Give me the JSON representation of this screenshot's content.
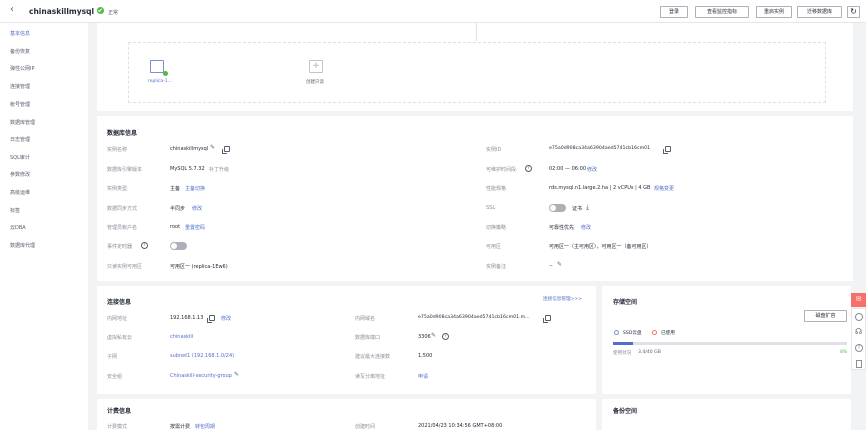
{
  "header": {
    "title": "chinaskillmysql",
    "status": "正常",
    "buttons": [
      "登录",
      "查看监控指标",
      "重启实例",
      "迁移数据库"
    ],
    "refresh_icon": "refresh-icon"
  },
  "sidebar": {
    "items": [
      "基本信息",
      "备份恢复",
      "弹性公网IP",
      "连接管理",
      "帐号管理",
      "数据库管理",
      "日志管理",
      "SQL审计",
      "参数修改",
      "高级运维",
      "标签",
      "云DBA",
      "数据库代理"
    ],
    "active": 0
  },
  "topology": {
    "node_label": "replica-1...",
    "create_label": "创建只读"
  },
  "db_info": {
    "title": "数据库信息",
    "left": [
      {
        "label": "实例名称",
        "value": "chinaskillmysql"
      },
      {
        "label": "数据库引擎版本",
        "value": "MySQL 5.7.32",
        "link": "补丁升级"
      },
      {
        "label": "实例类型",
        "value": "主备",
        "link": "主备切换"
      },
      {
        "label": "数据同步方式",
        "value": "半同步",
        "link": "修改"
      },
      {
        "label": "管理员帐户名",
        "value": "root",
        "link": "重置密码"
      },
      {
        "label": "事件定时器"
      },
      {
        "label": "只读实例可用区",
        "value": "可用区一 (replica-1Ew6)"
      }
    ],
    "right": [
      {
        "label": "实例ID",
        "value": "e75a0d908ca34a63904aed5741cb16cm01"
      },
      {
        "label": "可维护时间段",
        "value": "02:00 — 06:00",
        "link": "修改"
      },
      {
        "label": "性能规格",
        "value": "rds.mysql.n1.large.2.ha | 2 vCPUs | 4 GB",
        "link": "规格变更"
      },
      {
        "label": "SSL",
        "value": "证书"
      },
      {
        "label": "切换策略",
        "value": "可靠性优先",
        "link": "修改"
      },
      {
        "label": "可用区",
        "value": "可用区一（主可用区），可用区一（备可用区）"
      },
      {
        "label": "实例备注",
        "value": "--"
      }
    ]
  },
  "conn_info": {
    "title": "连接信息",
    "manage_link": "连接信息管理>>>",
    "left": [
      {
        "label": "内网地址",
        "value": "192.168.1.13",
        "link": "修改"
      },
      {
        "label": "虚拟私有云",
        "value": "chinaskill",
        "is_link": true
      },
      {
        "label": "子网",
        "value": "subnet1 (192.168.1.0/24)",
        "is_link": true
      },
      {
        "label": "安全组",
        "value": "Chinaskill-security-group",
        "is_link": true
      }
    ],
    "right": [
      {
        "label": "内网域名",
        "value": "e75a0d908ca34a63904aed5741cb16cm01.m..."
      },
      {
        "label": "数据库端口",
        "value": "3306"
      },
      {
        "label": "建议最大连接数",
        "value": "1,500"
      },
      {
        "label": "读写分离地址",
        "link": "申请"
      }
    ]
  },
  "storage": {
    "title": "存储空间",
    "expand_button": "磁盘扩容",
    "legend_ssd": "SSD云盘",
    "legend_used": "已使用",
    "usage_label": "使用状况",
    "usage_value": "3.4/40 GB",
    "usage_percent": "8%",
    "fill_fraction": 0.085
  },
  "billing": {
    "title": "计费信息",
    "label": "计费模式",
    "value": "按需计费",
    "link": "转包周期",
    "created_label": "创建时间",
    "created_value": "2021/04/23 10:34:56 GMT+08:00"
  },
  "backup": {
    "title": "备份空间"
  },
  "colors": {
    "accent": "#526ecc",
    "status_green": "#50b848",
    "help_red": "#f66f6a"
  }
}
